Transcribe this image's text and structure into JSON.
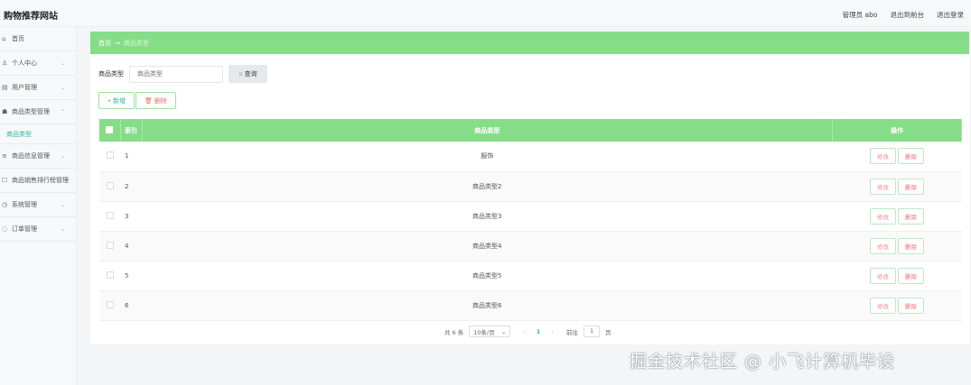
{
  "header": {
    "title": "购物推荐网站",
    "user": "管理员 abo",
    "front": "退出到前台",
    "logout": "退出登录"
  },
  "sidebar": {
    "items": [
      {
        "icon": "home-icon",
        "label": "首页",
        "glyph": "⌂",
        "chev": false
      },
      {
        "icon": "user-icon",
        "label": "个人中心",
        "glyph": "♙",
        "chev": true
      },
      {
        "icon": "users-icon",
        "label": "用户管理",
        "glyph": "▤",
        "chev": true
      },
      {
        "icon": "category-icon",
        "label": "商品类型管理",
        "glyph": "☗",
        "chev": true,
        "open": true
      },
      {
        "icon": "list-icon",
        "label": "商品信息管理",
        "glyph": "≡",
        "chev": true
      },
      {
        "icon": "rank-icon",
        "label": "商品销售排行榜管理",
        "glyph": "☐",
        "chev": true
      },
      {
        "icon": "settings-icon",
        "label": "系统管理",
        "glyph": "◷",
        "chev": true
      },
      {
        "icon": "order-icon",
        "label": "订单管理",
        "glyph": "◌",
        "chev": true
      }
    ],
    "sub_item": "商品类型"
  },
  "breadcrumb": {
    "home": "首页",
    "arrow": "→",
    "current": "商品类型"
  },
  "search": {
    "label": "商品类型",
    "placeholder": "商品类型",
    "button": "查询"
  },
  "actions": {
    "add": "+ 新增",
    "delete": "删除"
  },
  "table": {
    "headers": [
      "索引",
      "商品类型",
      "操作"
    ],
    "rows": [
      {
        "index": "1",
        "type": "服饰"
      },
      {
        "index": "2",
        "type": "商品类型2"
      },
      {
        "index": "3",
        "type": "商品类型3"
      },
      {
        "index": "4",
        "type": "商品类型4"
      },
      {
        "index": "5",
        "type": "商品类型5"
      },
      {
        "index": "6",
        "type": "商品类型6"
      }
    ],
    "edit": "修改",
    "delete": "删除"
  },
  "pagination": {
    "total": "共 6 条",
    "page_size": "10条/页",
    "current": "1",
    "goto": "前往",
    "page_input": "1",
    "page_unit": "页"
  },
  "watermark": "掘金技术社区 @ 小飞计算机毕设"
}
